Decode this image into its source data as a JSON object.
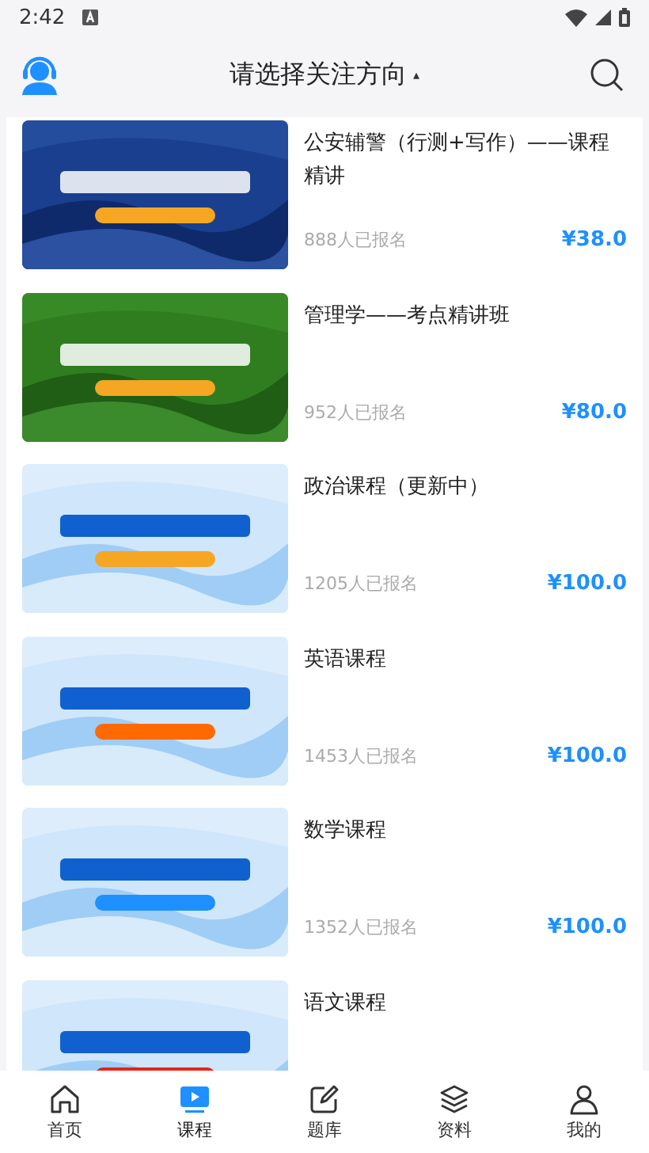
{
  "status_bar": {
    "time": "2:42"
  },
  "header": {
    "title": "请选择关注方向",
    "caret": "▴"
  },
  "courses": [
    {
      "title": "公安辅警（行测+写作）——课程精讲",
      "enrolled": "888人已报名",
      "price": "¥38.0"
    },
    {
      "title": "管理学——考点精讲班",
      "enrolled": "952人已报名",
      "price": "¥80.0"
    },
    {
      "title": "政治课程（更新中）",
      "enrolled": "1205人已报名",
      "price": "¥100.0"
    },
    {
      "title": "英语课程",
      "enrolled": "1453人已报名",
      "price": "¥100.0"
    },
    {
      "title": "数学课程",
      "enrolled": "1352人已报名",
      "price": "¥100.0"
    },
    {
      "title": "语文课程"
    }
  ],
  "tabs": [
    {
      "kind": "home",
      "label": "首页",
      "selected": false
    },
    {
      "kind": "course",
      "label": "课程",
      "selected": true
    },
    {
      "kind": "quiz",
      "label": "题库",
      "selected": false
    },
    {
      "kind": "material",
      "label": "资料",
      "selected": false
    },
    {
      "kind": "me",
      "label": "我的",
      "selected": false
    }
  ]
}
